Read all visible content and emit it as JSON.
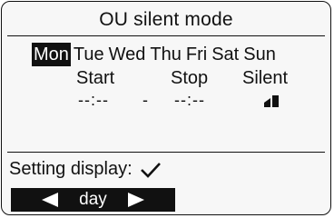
{
  "screen": {
    "title": "OU silent mode",
    "days": [
      {
        "label": "Mon",
        "selected": true
      },
      {
        "label": "Tue",
        "selected": false
      },
      {
        "label": "Wed",
        "selected": false
      },
      {
        "label": "Thu",
        "selected": false
      },
      {
        "label": "Fri",
        "selected": false
      },
      {
        "label": "Sat",
        "selected": false
      },
      {
        "label": "Sun",
        "selected": false
      }
    ],
    "columns": {
      "start": "Start",
      "stop": "Stop",
      "silent": "Silent"
    },
    "values": {
      "start": "--:--",
      "separator": "-",
      "stop": "--:--",
      "silent_icon": "silent-level-icon"
    },
    "setting_display": {
      "label": "Setting display:",
      "icon": "check-icon"
    },
    "nav": {
      "label": "day",
      "left_icon": "left-arrow-icon",
      "right_icon": "right-arrow-icon"
    }
  }
}
